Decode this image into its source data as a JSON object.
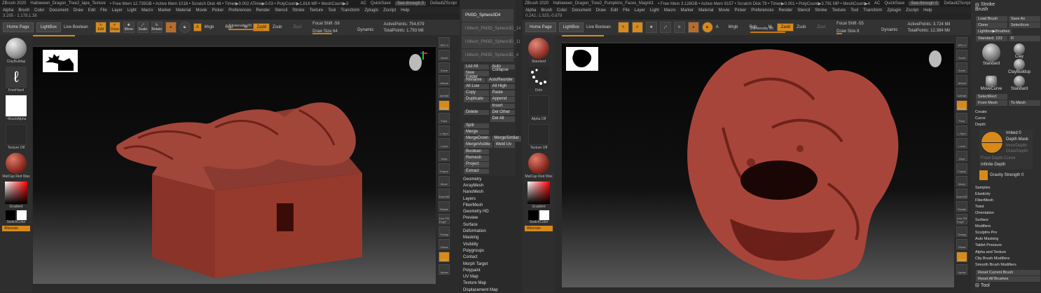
{
  "left": {
    "title": {
      "app": "ZBrush 2020",
      "doc": "Halloween_Dragon_Tree2_lapa_Texture",
      "stats": "• Free Mem 12.735GB • Active Mem 1018 • Scratch Disk 48 • Timer▶0.002 ATime▶0.03 • PolyCount▶1.816 MP • MeshCount▶3",
      "ac": "AC",
      "quicksave": "QuickSave",
      "seethrough": "See-through  0",
      "script": "DefaultZScript"
    },
    "menu": [
      "Alpha",
      "Brush",
      "Color",
      "Document",
      "Draw",
      "Edit",
      "File",
      "Layer",
      "Light",
      "Macro",
      "Marker",
      "Material",
      "Movie",
      "Picker",
      "Preferences",
      "Render",
      "Stencil",
      "Stroke",
      "Texture",
      "Tool",
      "Transform",
      "Zplugin",
      "Zscript",
      "Help"
    ],
    "status": "3.295 - 1.178,1.38",
    "shelf": {
      "home": "Home Page",
      "lightbox": "LightBox",
      "liveboolean": "Live Boolean",
      "edit": "Edit",
      "draw": "Draw",
      "move": "Move",
      "scale": "Scale",
      "rotate": "Rotate",
      "a": "A",
      "mrgb": "Mrgb",
      "rgb": "Rgb",
      "m": "M",
      "rgbintensity": "Rgb Intensity",
      "zadd": "Zadd",
      "zsub": "Zsub",
      "zcut": "Zcut",
      "zintensity": "Z Intensity 20",
      "focal": "Focal Shift -56",
      "drawsize": "Draw Size 64",
      "dynamic": "Dynamic",
      "active": "ActivePoints: 754,679",
      "total": "TotalPoints: 1.793 Mil"
    },
    "leftshelf": {
      "brush": "ClayBuildup",
      "stroke": "FreeHand",
      "alpha": "~BrushAlpha",
      "texture": "Texture Off",
      "material": "MatCap Red Wax",
      "gradient": "Gradient",
      "switchcolor": "SwitchColor",
      "alternate": "Alternate"
    },
    "rightshelf": [
      "SPix 3",
      "Scroll",
      "Zoom",
      "Actual",
      "AAHalf",
      "Persp",
      "Floor",
      "L.Sym",
      "Local",
      "Gxyz",
      "Frame",
      "Move",
      "Zoom3D",
      "Rotate",
      "Line Fill PolyF",
      "Transp",
      "Ghost",
      "Solo",
      "Xpose"
    ]
  },
  "subtool": {
    "items": [
      "PM3D_Sphere3D4",
      "UMesh_PM3D_Sphere3D_14",
      "UMesh_PM3D_Sphere3D_11",
      "UMesh_PM3D_Sphere3D_4"
    ],
    "rows": [
      [
        "List All",
        "Auto Collapse"
      ],
      [
        "New Folder",
        ""
      ],
      [
        "Rename",
        "AutoReorder"
      ],
      [
        "All Low",
        "All High"
      ],
      [
        "Copy",
        "Paste"
      ],
      [
        "Duplicate",
        "Append"
      ],
      [
        "",
        "Insert"
      ],
      [
        "Delete",
        "Del Other"
      ],
      [
        "",
        "Del All"
      ],
      [
        "Split",
        ""
      ],
      [
        "Merge",
        ""
      ],
      [
        "MergeDown",
        "MergeSimilar"
      ],
      [
        "MergeVisible",
        "Weld  Uv"
      ],
      [
        "Boolean",
        ""
      ],
      [
        "Remesh",
        ""
      ],
      [
        "Project",
        ""
      ],
      [
        "Extract",
        ""
      ]
    ],
    "sections": [
      "Geometry",
      "ArrayMesh",
      "NanoMesh",
      "Layers",
      "FiberMesh",
      "Geometry HD",
      "Preview",
      "Surface",
      "Deformation",
      "Masking",
      "Visibility",
      "Polygroups",
      "Contact",
      "Morph Target",
      "Polypaint",
      "UV Map",
      "Texture Map",
      "Displacement Map"
    ]
  },
  "right": {
    "title": {
      "app": "ZBrush 2020",
      "doc": "Halloween_Dragon_Tree2_Pumpkins_Faces_Magnit1",
      "stats": "• Free Mem 3.128GB • Active Mem 9157 • Scratch Disk 79 • Timer▶0.001 • PolyCount▶3.791 MP • MeshCount▶4",
      "ac": "AC",
      "quicksave": "QuickSave",
      "seethrough": "See-through  0",
      "script": "DefaultZScript"
    },
    "menu": [
      "Alpha",
      "Brush",
      "Color",
      "Document",
      "Draw",
      "Edit",
      "File",
      "Layer",
      "Light",
      "Macro",
      "Marker",
      "Material",
      "Movie",
      "Picker",
      "Preferences",
      "Render",
      "Stencil",
      "Stroke",
      "Texture",
      "Tool",
      "Transform",
      "Zplugin",
      "Zscript",
      "Help"
    ],
    "status": "0.242,-1.925,-0.879",
    "shelf": {
      "home": "Home Page",
      "lightbox": "LightBox",
      "liveboolean": "Live Boolean",
      "a": "A",
      "mrgb": "Mrgb",
      "rgb": "Rgb",
      "m": "M",
      "zadd": "Zadd",
      "zsub": "Zsub",
      "zcut": "Zcut",
      "zintensity": "Z Intensity 25",
      "focal": "Focal Shift -55",
      "drawsize": "Draw Size 8",
      "dynamic": "Dynamic",
      "active": "ActivePoints: 3.724 Mil",
      "total": "TotalPoints: 12.384 Mil"
    },
    "leftshelf": {
      "brush": "Standard",
      "stroke": "Dots",
      "alpha": "Alpha Off",
      "texture": "Texture Off",
      "material": "MatCap Red Wax",
      "gradient": "Gradient",
      "switchcolor": "SwitchColor",
      "alternate": "Alternate"
    },
    "rightshelf": [
      "SPix 3",
      "Scroll",
      "Zoom",
      "Actual",
      "AAHalf",
      "Persp",
      "Floor",
      "L.Sym",
      "Local",
      "Gxyz",
      "Frame",
      "Move",
      "Zoom3D",
      "Rotate",
      "Line Fill PolyF",
      "Transp",
      "Ghost",
      "Solo",
      "Xpose"
    ]
  },
  "brushpanel": {
    "stroke": "Stroke",
    "brush": "Brush",
    "rows": [
      [
        "Load Brush",
        "Save As"
      ],
      [
        "Clone",
        "SelectIcon"
      ],
      [
        "Lightbox▶Brushes",
        ""
      ],
      [
        "Standard. 133",
        "R"
      ]
    ],
    "brushes": [
      "Standard",
      "Clay",
      "ClayBuildup",
      "MoveCurve",
      "Standard"
    ],
    "rows2": [
      [
        "SelectRect",
        ""
      ],
      [
        "From Mesh",
        "To Mesh"
      ]
    ],
    "sections": [
      "Create",
      "Curve",
      "Depth"
    ],
    "depth": {
      "imbed": "Imbed 0",
      "mask": "Depth Mask",
      "inner": "InnerDepth",
      "outer": "OuterDepth",
      "auto": "Front Depth Curve",
      "infinite": "Infinite Depth",
      "gravity": "Gravity Strength 0"
    },
    "sections2": [
      "Samples",
      "Elasticity",
      "FiberMesh",
      "Twist",
      "Orientation",
      "Surface",
      "Modifiers",
      "Sculptris Pro",
      "Auto Masking",
      "Tablet Pressure",
      "Alpha and Texture",
      "Clip Brush Modifiers",
      "Smooth Brush Modifiers"
    ],
    "reset": [
      "Reset Current Brush",
      "Reset All Brushes"
    ],
    "tool": "Tool"
  },
  "colors": {
    "accent": "#d78a1a",
    "clay": "#a8453a"
  }
}
